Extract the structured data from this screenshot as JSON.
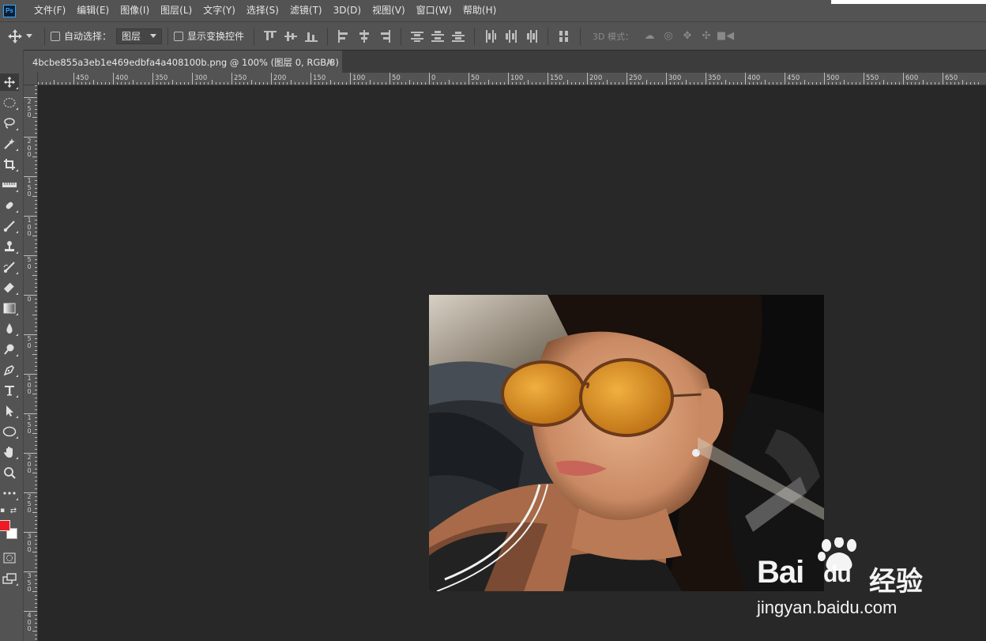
{
  "app": {
    "logo_text": "Ps"
  },
  "menu": [
    "文件(F)",
    "编辑(E)",
    "图像(I)",
    "图层(L)",
    "文字(Y)",
    "选择(S)",
    "滤镜(T)",
    "3D(D)",
    "视图(V)",
    "窗口(W)",
    "帮助(H)"
  ],
  "options": {
    "auto_select_label": "自动选择：",
    "auto_select_value": "图层",
    "show_transform_label": "显示变换控件",
    "mode_3d_label": "3D 模式："
  },
  "document": {
    "tab_title": "4bcbe855a3eb1e469edbfa4a408100b.png @ 100% (图层 0, RGB/8)",
    "close_glyph": "×"
  },
  "ruler": {
    "h_labels": [
      "450",
      "400",
      "350",
      "300",
      "250",
      "200",
      "150",
      "100",
      "50",
      "0",
      "50",
      "100",
      "150",
      "200",
      "250",
      "300",
      "350",
      "400",
      "450",
      "500",
      "550",
      "600",
      "650"
    ],
    "v_labels": [
      "250",
      "200",
      "150",
      "100",
      "50",
      "0",
      "50",
      "100",
      "150",
      "200",
      "250",
      "300",
      "350",
      "400"
    ]
  },
  "tools": [
    "move-tool",
    "marquee-tool",
    "lasso-tool",
    "magic-wand-tool",
    "crop-tool",
    "ruler-tool",
    "healing-tool",
    "brush-tool",
    "stamp-tool",
    "history-brush-tool",
    "eraser-tool",
    "gradient-tool",
    "blur-tool",
    "dodge-tool",
    "pen-tool",
    "type-tool",
    "path-select-tool",
    "ellipse-tool",
    "hand-tool",
    "zoom-tool",
    "more-tools"
  ],
  "colors": {
    "foreground": "#ed1c24",
    "background": "#ffffff"
  },
  "watermark": {
    "brand": "Bai",
    "brand2": "du",
    "service": "经验",
    "url": "jingyan.baidu.com"
  }
}
